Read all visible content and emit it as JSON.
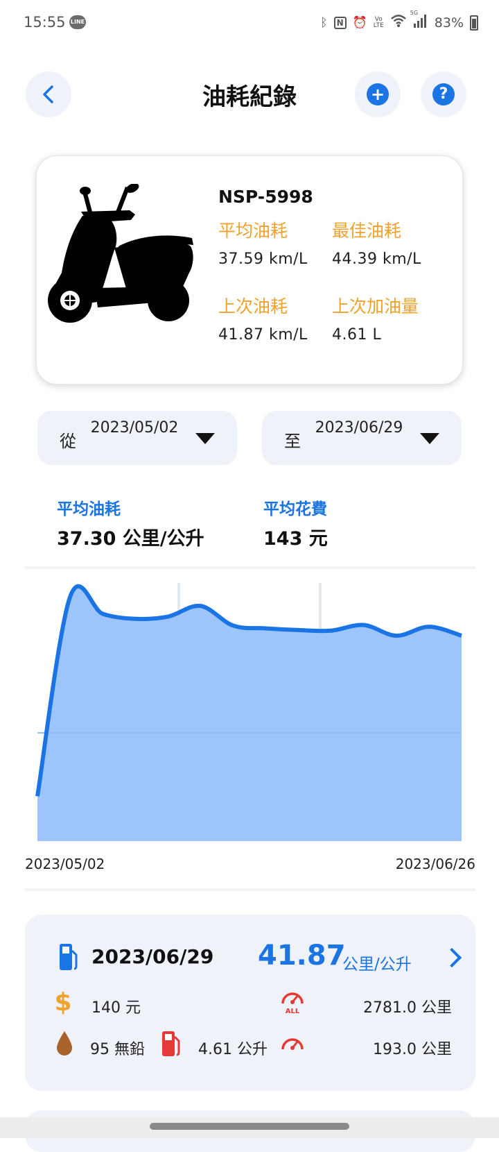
{
  "status_bar": {
    "time": "15:55",
    "line_badge": "LINE",
    "net_volte": "Vo",
    "net_lte": "LTE",
    "net_5g": "5G",
    "battery": "83%"
  },
  "header": {
    "title": "油耗紀錄"
  },
  "vehicle": {
    "plate": "NSP-5998",
    "avg_label": "平均油耗",
    "avg_value": "37.59 km/L",
    "best_label": "最佳油耗",
    "best_value": "44.39 km/L",
    "last_label": "上次油耗",
    "last_value": "41.87 km/L",
    "last_fill_label": "上次加油量",
    "last_fill_value": "4.61 L"
  },
  "filters": {
    "from_prefix": "從",
    "from_date": "2023/05/02",
    "to_prefix": "至",
    "to_date": "2023/06/29"
  },
  "summary": {
    "avg_eff_label": "平均油耗",
    "avg_eff_value": "37.30 公里/公升",
    "avg_cost_label": "平均花費",
    "avg_cost_value": "143 元"
  },
  "chart_data": {
    "type": "area",
    "x": [
      "2023/05/02",
      "2023/06/26"
    ],
    "values": [
      8,
      43.5,
      40.5,
      39.6,
      40.0,
      41.9,
      38.4,
      37.9,
      37.6,
      37.5,
      38.5,
      36.6,
      38.2,
      36.6
    ],
    "x_tick_labels": [
      "2023/05/02",
      "2023/06/26"
    ],
    "ylim": [
      0,
      46
    ],
    "grid": true,
    "color": "#1b74e4",
    "fill": "#9ec5fb"
  },
  "record": {
    "date": "2023/06/29",
    "efficiency": "41.87",
    "efficiency_unit": "公里/公升",
    "cost": "140 元",
    "total_km": "2781.0 公里",
    "total_icon_text": "ALL",
    "fuel_type": "95 無鉛",
    "volume": "4.61 公升",
    "trip_km": "193.0 公里"
  },
  "colors": {
    "accent": "#1b74e4",
    "orange": "#f0a22e",
    "red": "#e53935",
    "card_bg": "#eff2f8"
  }
}
